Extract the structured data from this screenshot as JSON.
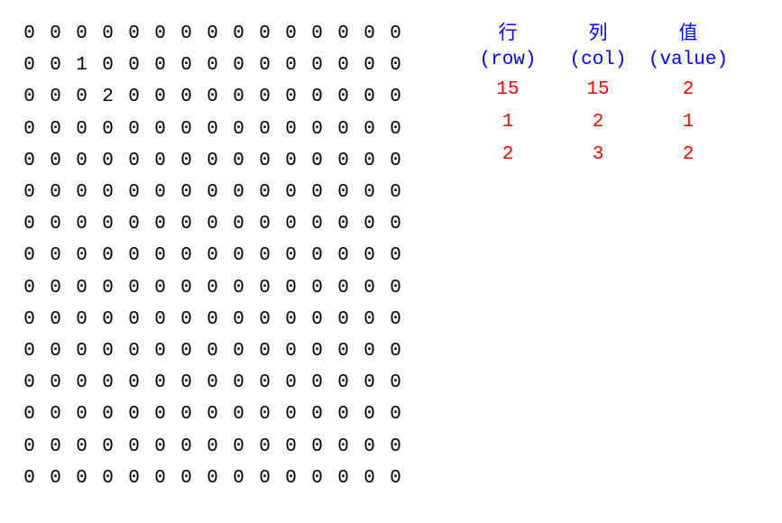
{
  "matrix": {
    "rows": 15,
    "cols": 15,
    "nonzero": {
      "1,2": 1,
      "2,3": 2
    }
  },
  "sparse": {
    "headers": [
      {
        "cn": "行",
        "en": "(row)"
      },
      {
        "cn": "列",
        "en": "(col)"
      },
      {
        "cn": "值",
        "en": "(value)"
      }
    ],
    "rows": [
      {
        "row": "15",
        "col": "15",
        "value": "2"
      },
      {
        "row": "1",
        "col": "2",
        "value": "1"
      },
      {
        "row": "2",
        "col": "3",
        "value": "2"
      }
    ]
  }
}
